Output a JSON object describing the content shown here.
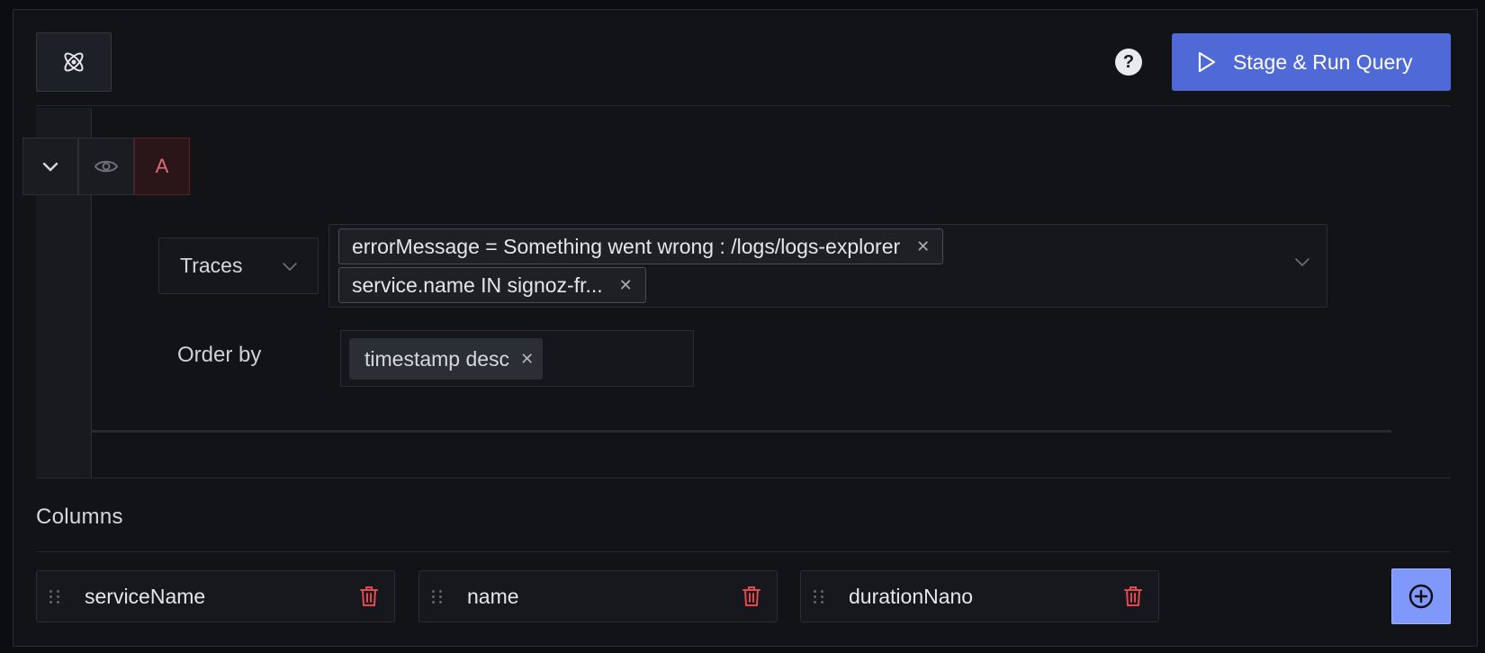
{
  "toolbar": {
    "ai_icon": "atom-icon",
    "help_icon": "help-icon",
    "help_glyph": "?",
    "run_button_label": "Stage & Run Query",
    "run_icon": "play-icon",
    "accent_color": "#4f6ad6"
  },
  "query": {
    "letter": "A",
    "collapse_icon": "chevron-down-icon",
    "visibility_icon": "eye-icon",
    "data_source": "Traces",
    "filters": [
      {
        "label": "errorMessage = Something went wrong : /logs/logs-explorer"
      },
      {
        "label": "service.name IN signoz-fr..."
      }
    ],
    "order_by_label": "Order by",
    "order_by": [
      {
        "label": "timestamp desc"
      }
    ]
  },
  "columns": {
    "title": "Columns",
    "items": [
      {
        "name": "serviceName"
      },
      {
        "name": "name"
      },
      {
        "name": "durationNano"
      }
    ],
    "add_icon": "plus-circle-icon",
    "delete_color": "#e5484d"
  }
}
